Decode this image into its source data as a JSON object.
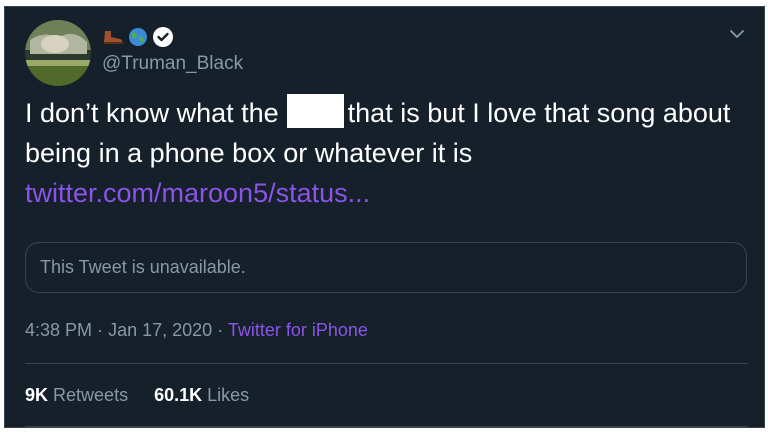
{
  "tweet": {
    "handle": "@Truman_Black",
    "text_before": "I don’t know what the",
    "text_after": "that is but I love that song about being in a phone box or whatever it is",
    "link": "twitter.com/maroon5/status...",
    "quote_unavailable": "This Tweet is unavailable.",
    "time": "4:38 PM",
    "separator": "·",
    "date": "Jan 17, 2020",
    "source": "Twitter for iPhone",
    "retweets_count": "9K",
    "retweets_label": "Retweets",
    "likes_count": "60.1K",
    "likes_label": "Likes"
  },
  "icons": {
    "emoji_1": "boot-icon",
    "emoji_2": "globe-icon",
    "verified": "verified-icon",
    "caret": "chevron-down-icon"
  },
  "colors": {
    "background": "#15202b",
    "border": "#38444d",
    "text": "#ffffff",
    "secondary": "#8899a6",
    "link": "#8a54e8"
  }
}
